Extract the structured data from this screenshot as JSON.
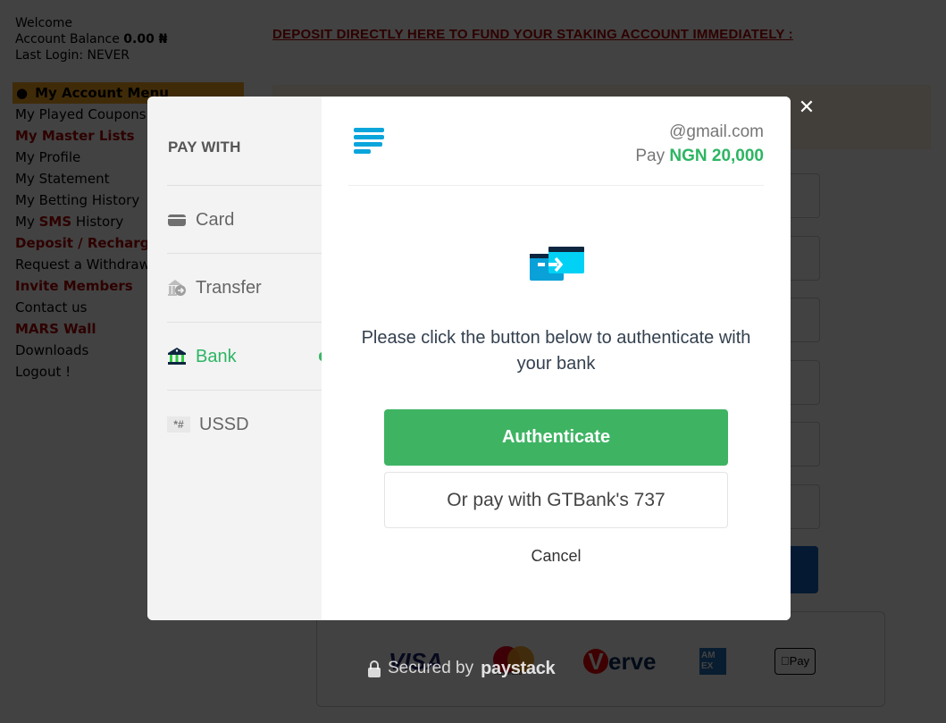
{
  "account": {
    "welcome": "Welcome",
    "balance_label": "Account Balance",
    "balance_value": "0.00 ₦",
    "last_login": "Last Login: NEVER"
  },
  "deposit_link": "DEPOSIT DIRECTLY HERE TO FUND YOUR STAKING ACCOUNT IMMEDIATELY :",
  "menu": {
    "header": "My Account Menu",
    "items": [
      {
        "label": "My Played Coupons",
        "highlight": false
      },
      {
        "label": "My Master Lists",
        "highlight": true
      },
      {
        "label": "My Profile",
        "highlight": false
      },
      {
        "label": "My Statement",
        "highlight": false
      },
      {
        "label": "My Betting History",
        "highlight": false
      },
      {
        "label_prefix": "My ",
        "label_red": "SMS",
        "label_suffix": " History",
        "highlight": false
      },
      {
        "label": "Deposit / Recharge",
        "highlight": true
      },
      {
        "label": "Request a Withdrawal",
        "highlight": false
      },
      {
        "label": "Invite Members",
        "highlight": true
      },
      {
        "label": "Contact us",
        "highlight": false
      },
      {
        "label": "MARS Wall",
        "highlight": true
      },
      {
        "label": "Downloads",
        "highlight": false
      },
      {
        "label": "Logout !",
        "highlight": false
      }
    ]
  },
  "card_logos": {
    "visa": "VISA",
    "mastercard": "mastercard",
    "verve_v": "V",
    "verve_rest": "erve",
    "amex": "AM EX",
    "apple_pay": "Pay"
  },
  "secured": {
    "prefix": "Secured by",
    "brand": "paystack"
  },
  "modal": {
    "close_icon": "close-icon",
    "pay_with": "PAY WITH",
    "channels": [
      {
        "label": "Card",
        "icon": "card-icon",
        "active": false
      },
      {
        "label": "Transfer",
        "icon": "transfer-icon",
        "active": false
      },
      {
        "label": "Bank",
        "icon": "bank-icon",
        "active": true
      },
      {
        "label": "USSD",
        "icon": "ussd-icon",
        "active": false
      }
    ],
    "ussd_glyph": "*#",
    "email": "@gmail.com",
    "pay_label": "Pay",
    "amount": "NGN 20,000",
    "instruction": "Please click the button below to authenticate with your bank",
    "authenticate_label": "Authenticate",
    "gtbank_label": "Or pay with GTBank's 737",
    "cancel_label": "Cancel"
  },
  "colors": {
    "accent_green": "#3eb463",
    "paystack_blue": "#09a5db",
    "menu_red": "#b00000",
    "menu_header": "#f5a623"
  }
}
